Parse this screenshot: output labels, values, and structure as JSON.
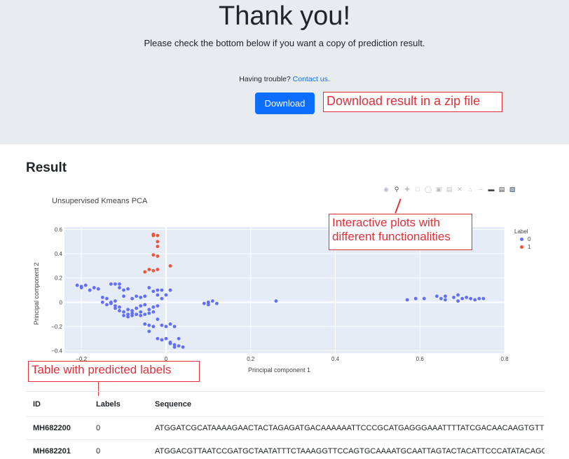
{
  "hero": {
    "title": "Thank you!",
    "subtitle": "Please check the bottom below if you want a copy of prediction result.",
    "trouble_text": "Having trouble?",
    "contact_link": "Contact us.",
    "download_label": "Download"
  },
  "annotations": {
    "download": "Download result in a zip file",
    "plot_line1": "Interactive plots with",
    "plot_line2": "different functionalities",
    "table": "Table with predicted labels"
  },
  "result": {
    "heading": "Result"
  },
  "modebar": {
    "icons": [
      "camera-icon",
      "zoom-icon",
      "pan-icon",
      "box-select-icon",
      "lasso-icon",
      "zoom-in-icon",
      "zoom-out-icon",
      "autoscale-icon",
      "reset-axes-icon",
      "spike-lines-icon",
      "hover-closest-icon",
      "hover-compare-icon",
      "plotly-logo-icon"
    ]
  },
  "chart_data": {
    "type": "scatter",
    "title": "Unsupervised Kmeans PCA",
    "xlabel": "Principal component 1",
    "ylabel": "Principal component 2",
    "xlim": [
      -0.24,
      0.8
    ],
    "ylim": [
      -0.42,
      0.62
    ],
    "xticks": [
      "−0.2",
      "0",
      "0.2",
      "0.4",
      "0.6",
      "0.8"
    ],
    "yticks": [
      "−0.4",
      "−0.2",
      "0",
      "0.2",
      "0.4",
      "0.6"
    ],
    "legend_title": "Label",
    "legend_position": "right",
    "background": "#e5ecf6",
    "series": [
      {
        "name": "0",
        "color": "#636efa",
        "points": [
          [
            -0.21,
            0.14
          ],
          [
            -0.2,
            0.13
          ],
          [
            -0.19,
            0.14
          ],
          [
            -0.2,
            0.12
          ],
          [
            -0.18,
            0.1
          ],
          [
            -0.17,
            0.12
          ],
          [
            -0.16,
            0.11
          ],
          [
            -0.15,
            0.04
          ],
          [
            -0.14,
            0.03
          ],
          [
            -0.15,
            0.0
          ],
          [
            -0.13,
            -0.01
          ],
          [
            -0.12,
            0.01
          ],
          [
            -0.14,
            -0.02
          ],
          [
            -0.13,
            0.15
          ],
          [
            -0.12,
            0.15
          ],
          [
            -0.11,
            0.15
          ],
          [
            -0.11,
            0.12
          ],
          [
            -0.1,
            0.1
          ],
          [
            -0.09,
            0.11
          ],
          [
            -0.1,
            0.05
          ],
          [
            -0.12,
            -0.05
          ],
          [
            -0.11,
            -0.07
          ],
          [
            -0.1,
            -0.08
          ],
          [
            -0.09,
            -0.1
          ],
          [
            -0.08,
            -0.09
          ],
          [
            -0.1,
            -0.11
          ],
          [
            -0.09,
            -0.12
          ],
          [
            -0.08,
            -0.11
          ],
          [
            -0.07,
            -0.1
          ],
          [
            -0.06,
            -0.11
          ],
          [
            -0.05,
            -0.1
          ],
          [
            -0.04,
            -0.09
          ],
          [
            -0.03,
            -0.08
          ],
          [
            -0.07,
            -0.05
          ],
          [
            -0.06,
            -0.03
          ],
          [
            -0.05,
            -0.02
          ],
          [
            -0.08,
            0.03
          ],
          [
            -0.07,
            0.05
          ],
          [
            -0.06,
            0.04
          ],
          [
            -0.05,
            0.05
          ],
          [
            -0.04,
            0.12
          ],
          [
            -0.03,
            0.09
          ],
          [
            -0.02,
            0.06
          ],
          [
            -0.01,
            0.03
          ],
          [
            0.0,
            0.06
          ],
          [
            -0.02,
            0.1
          ],
          [
            -0.01,
            0.1
          ],
          [
            0.01,
            0.1
          ],
          [
            -0.05,
            -0.18
          ],
          [
            -0.04,
            -0.19
          ],
          [
            -0.03,
            -0.2
          ],
          [
            -0.04,
            -0.24
          ],
          [
            -0.02,
            -0.14
          ],
          [
            -0.01,
            -0.19
          ],
          [
            0.0,
            -0.2
          ],
          [
            0.01,
            -0.18
          ],
          [
            0.02,
            -0.2
          ],
          [
            -0.02,
            -0.3
          ],
          [
            -0.01,
            -0.31
          ],
          [
            0.0,
            -0.3
          ],
          [
            0.01,
            -0.34
          ],
          [
            0.02,
            -0.35
          ],
          [
            0.03,
            -0.36
          ],
          [
            0.04,
            -0.37
          ],
          [
            0.02,
            -0.37
          ],
          [
            0.01,
            -0.33
          ],
          [
            0.03,
            -0.3
          ],
          [
            -0.11,
            -0.04
          ],
          [
            -0.12,
            -0.03
          ],
          [
            -0.13,
            0.0
          ],
          [
            -0.09,
            -0.06
          ],
          [
            -0.08,
            -0.07
          ],
          [
            -0.06,
            -0.08
          ],
          [
            -0.04,
            -0.06
          ],
          [
            -0.03,
            -0.04
          ],
          [
            -0.02,
            -0.03
          ],
          [
            0.1,
            0.0
          ],
          [
            0.11,
            0.01
          ],
          [
            0.1,
            -0.02
          ],
          [
            0.12,
            -0.01
          ],
          [
            0.09,
            -0.01
          ],
          [
            0.26,
            0.01
          ],
          [
            0.57,
            0.02
          ],
          [
            0.59,
            0.03
          ],
          [
            0.61,
            0.03
          ],
          [
            0.65,
            0.03
          ],
          [
            0.66,
            0.02
          ],
          [
            0.68,
            0.04
          ],
          [
            0.69,
            0.06
          ],
          [
            0.7,
            0.03
          ],
          [
            0.71,
            0.04
          ],
          [
            0.69,
            0.01
          ],
          [
            0.72,
            0.03
          ],
          [
            0.73,
            0.02
          ],
          [
            0.74,
            0.03
          ],
          [
            0.75,
            0.03
          ],
          [
            0.64,
            0.05
          ],
          [
            0.66,
            0.05
          ]
        ]
      },
      {
        "name": "1",
        "color": "#ef553b",
        "points": [
          [
            -0.03,
            0.55
          ],
          [
            -0.02,
            0.55
          ],
          [
            -0.03,
            0.56
          ],
          [
            -0.02,
            0.5
          ],
          [
            -0.02,
            0.46
          ],
          [
            -0.03,
            0.39
          ],
          [
            -0.02,
            0.38
          ],
          [
            -0.04,
            0.27
          ],
          [
            -0.05,
            0.25
          ],
          [
            -0.03,
            0.26
          ],
          [
            -0.02,
            0.27
          ],
          [
            0.01,
            0.3
          ]
        ]
      }
    ]
  },
  "table": {
    "headers": [
      "ID",
      "Labels",
      "Sequence"
    ],
    "rows": [
      {
        "id": "MH682200",
        "label": "0",
        "sequence": "ATGGATCGCATAAAAGAACTACTAGAGATGACAAAAAATTCCCGCATGAGGGAAATTTTATCGACAACAAGTGTTGACCAG"
      },
      {
        "id": "MH682201",
        "label": "0",
        "sequence": "ATGGACGTTAATCCGATGCTAATATTTCTAAAGGTTCCAGTGCAAAATGCAATTAGTACTACATTCCCATATACAGGGGACC"
      }
    ]
  }
}
